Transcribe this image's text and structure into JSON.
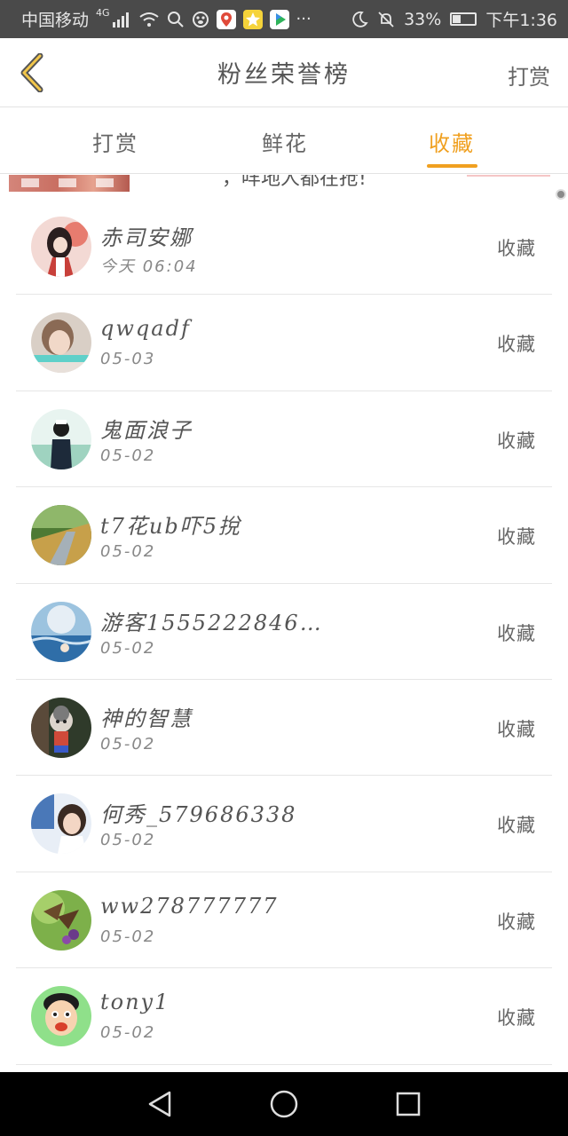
{
  "status_bar": {
    "carrier": "中国移动",
    "network": "4G",
    "battery": "33%",
    "time": "下午1:36",
    "icons": [
      "signal-icon",
      "wifi-icon",
      "search-icon",
      "paw-icon",
      "map-pin-icon",
      "star-icon",
      "video-icon",
      "more-icon",
      "moon-icon",
      "mute-icon",
      "battery-icon"
    ]
  },
  "header": {
    "title": "粉丝荣誉榜",
    "right_action": "打赏"
  },
  "tabs": [
    {
      "label": "打赏"
    },
    {
      "label": "鲜花"
    },
    {
      "label": "收藏"
    }
  ],
  "active_tab": "收藏",
  "ad": {
    "text": "，咩地人都在抢!"
  },
  "list": [
    {
      "name": "赤司安娜",
      "time": "今天 06:04",
      "action": "收藏"
    },
    {
      "name": "qwqadf",
      "time": "05-03",
      "action": "收藏"
    },
    {
      "name": "鬼面浪子",
      "time": "05-02",
      "action": "收藏"
    },
    {
      "name": "t7花ub吓5挩",
      "time": "05-02",
      "action": "收藏"
    },
    {
      "name": "游客1555222846…",
      "time": "05-02",
      "action": "收藏"
    },
    {
      "name": "神的智慧",
      "time": "05-02",
      "action": "收藏"
    },
    {
      "name": "何秀_579686338",
      "time": "05-02",
      "action": "收藏"
    },
    {
      "name": "ww278777777",
      "time": "05-02",
      "action": "收藏"
    },
    {
      "name": "tony1",
      "time": "05-02",
      "action": "收藏"
    }
  ],
  "colors": {
    "accent": "#f0a020",
    "status_bar": "#4a4a4a",
    "nav_bar": "#000000",
    "divider": "#e6e6e6"
  }
}
